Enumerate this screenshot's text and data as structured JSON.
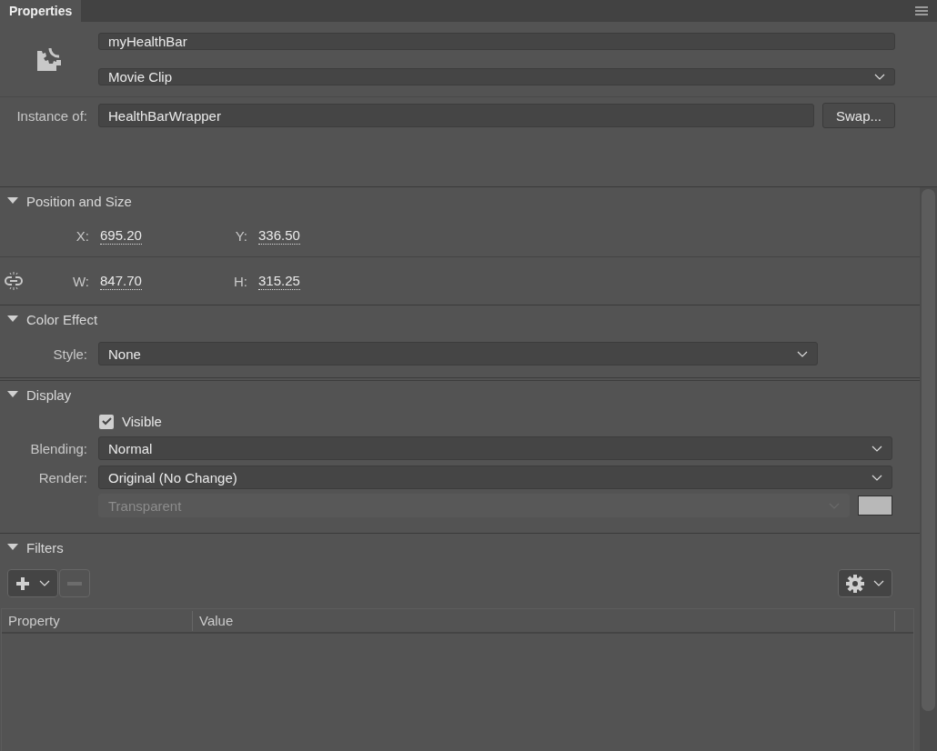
{
  "tab": {
    "label": "Properties",
    "selected": true
  },
  "instance": {
    "name": "myHealthBar",
    "type": "Movie Clip",
    "instance_of_label": "Instance of:",
    "instance_of": "HealthBarWrapper",
    "swap_button": "Swap..."
  },
  "position_and_size": {
    "title": "Position and Size",
    "expanded": true,
    "x": {
      "label": "X:",
      "value": "695.20"
    },
    "y": {
      "label": "Y:",
      "value": "336.50"
    },
    "w": {
      "label": "W:",
      "value": "847.70"
    },
    "h": {
      "label": "H:",
      "value": "315.25"
    }
  },
  "color_effect": {
    "title": "Color Effect",
    "expanded": true,
    "style": {
      "label": "Style:",
      "value": "None"
    }
  },
  "display": {
    "title": "Display",
    "expanded": true,
    "visible": {
      "label": "Visible",
      "checked": true
    },
    "blending": {
      "label": "Blending:",
      "value": "Normal"
    },
    "render": {
      "label": "Render:",
      "value": "Original (No Change)"
    },
    "background": {
      "value": "Transparent",
      "disabled": true
    }
  },
  "filters": {
    "title": "Filters",
    "expanded": true,
    "columns": [
      "Property",
      "Value"
    ]
  }
}
